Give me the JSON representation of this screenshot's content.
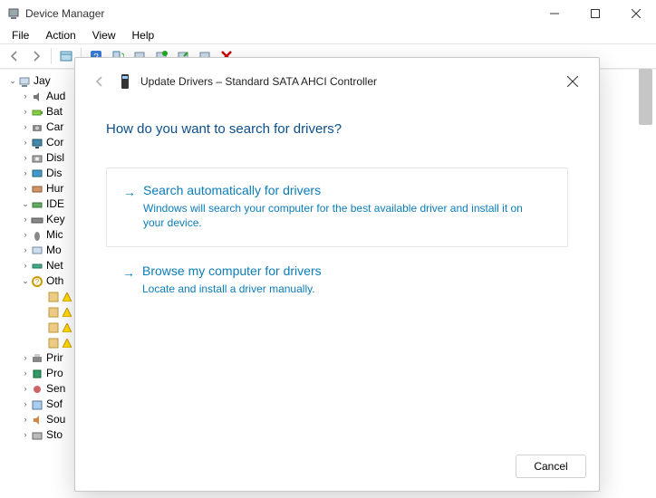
{
  "window": {
    "title": "Device Manager"
  },
  "menubar": {
    "items": [
      "File",
      "Action",
      "View",
      "Help"
    ]
  },
  "toolbar": {
    "icons": [
      "back-icon",
      "forward-icon",
      "sep",
      "show-hidden-icon",
      "sep",
      "help-icon",
      "scan-icon",
      "monitor-icon",
      "add-legacy-icon",
      "update-driver-icon",
      "uninstall-icon",
      "delete-icon"
    ]
  },
  "tree": {
    "root": {
      "label": "Jay",
      "expanded": true
    },
    "children": [
      {
        "icon": "audio-icon",
        "label": "Aud",
        "expander": ">"
      },
      {
        "icon": "battery-icon",
        "label": "Bat",
        "expander": ">"
      },
      {
        "icon": "camera-icon",
        "label": "Car",
        "expander": ">"
      },
      {
        "icon": "computer-icon",
        "label": "Cor",
        "expander": ">"
      },
      {
        "icon": "disk-icon",
        "label": "Disl",
        "expander": ">"
      },
      {
        "icon": "display-icon",
        "label": "Dis",
        "expander": ">"
      },
      {
        "icon": "hid-icon",
        "label": "Hur",
        "expander": ">"
      },
      {
        "icon": "ide-icon",
        "label": "IDE",
        "expander": "v"
      },
      {
        "icon": "keyboard-icon",
        "label": "Key",
        "expander": ">"
      },
      {
        "icon": "mouse-icon",
        "label": "Mic",
        "expander": ">"
      },
      {
        "icon": "monitor-icon",
        "label": "Mo",
        "expander": ">"
      },
      {
        "icon": "network-icon",
        "label": "Net",
        "expander": ">"
      },
      {
        "icon": "other-icon",
        "label": "Oth",
        "expander": "v"
      },
      {
        "icon": "printer-icon",
        "label": "Prir",
        "expander": ">"
      },
      {
        "icon": "processor-icon",
        "label": "Pro",
        "expander": ">"
      },
      {
        "icon": "sensor-icon",
        "label": "Sen",
        "expander": ">"
      },
      {
        "icon": "software-icon",
        "label": "Sof",
        "expander": ">"
      },
      {
        "icon": "sound-icon",
        "label": "Sou",
        "expander": ">"
      },
      {
        "icon": "storage-icon",
        "label": "Sto",
        "expander": ">"
      }
    ],
    "other_children_count": 4
  },
  "modal": {
    "title": "Update Drivers – Standard SATA AHCI Controller",
    "heading": "How do you want to search for drivers?",
    "option1": {
      "title": "Search automatically for drivers",
      "desc": "Windows will search your computer for the best available driver and install it on your device."
    },
    "option2": {
      "title": "Browse my computer for drivers",
      "desc": "Locate and install a driver manually."
    },
    "cancel_label": "Cancel"
  }
}
